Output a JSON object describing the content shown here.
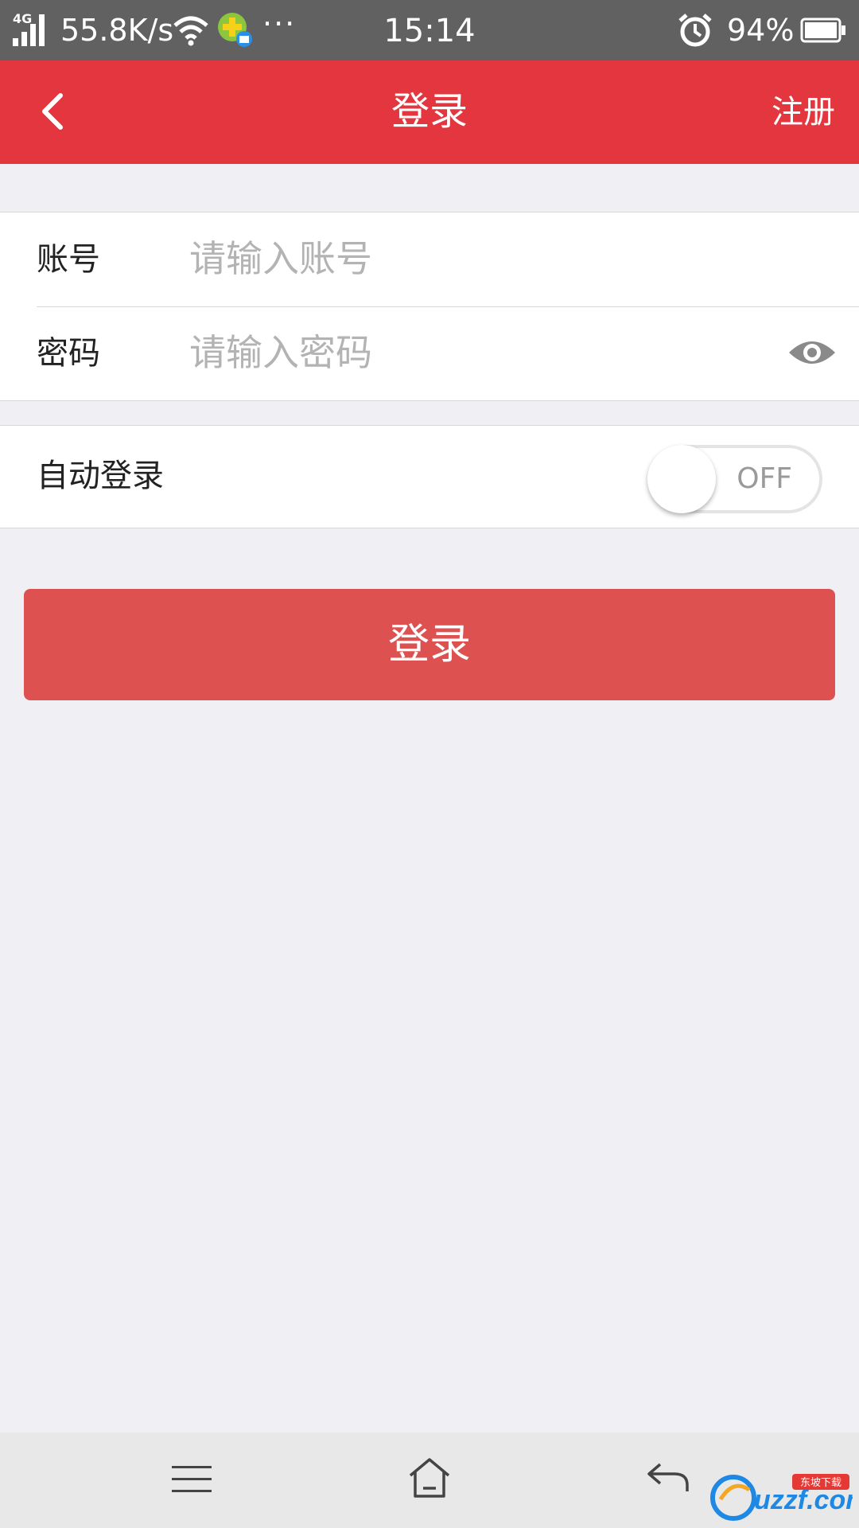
{
  "status_bar": {
    "network_type": "4G",
    "net_speed": "55.8K/s",
    "more": "···",
    "time": "15:14",
    "battery_percent": "94%"
  },
  "header": {
    "title": "登录",
    "register_label": "注册"
  },
  "form": {
    "account_label": "账号",
    "account_placeholder": "请输入账号",
    "account_value": "",
    "password_label": "密码",
    "password_placeholder": "请输入密码",
    "password_value": ""
  },
  "auto_login": {
    "label": "自动登录",
    "toggle_text": "OFF",
    "enabled": false
  },
  "login_button": {
    "label": "登录"
  },
  "colors": {
    "header_red": "#e3363e",
    "button_red": "#dd5250",
    "page_bg": "#efeff4"
  },
  "icons": {
    "back": "chevron-left-icon",
    "eye": "eye-icon",
    "menu": "menu-icon",
    "home": "home-icon",
    "nav_back": "back-arrow-icon"
  },
  "watermark": {
    "text": "uzzf.com",
    "badge": "东坡下载"
  }
}
